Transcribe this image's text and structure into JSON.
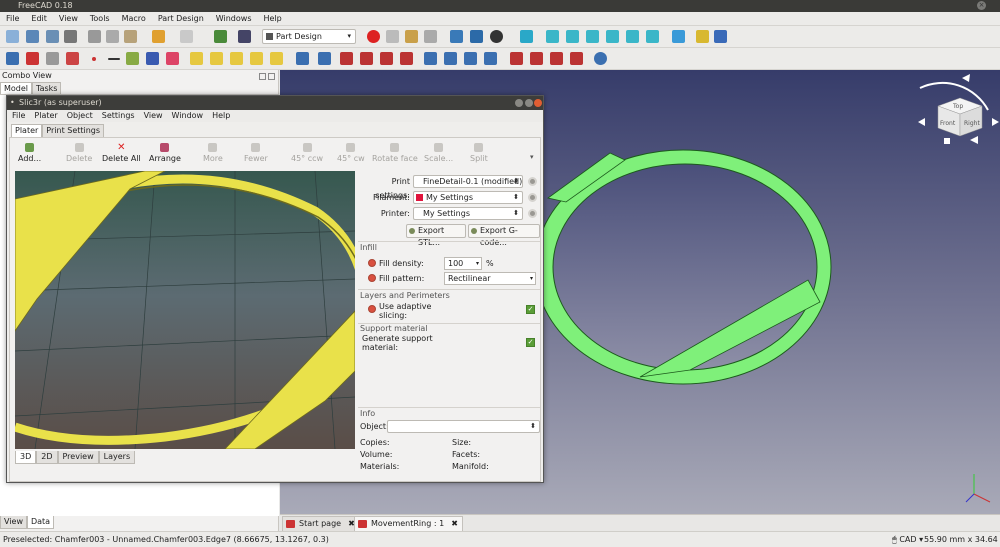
{
  "freecad": {
    "title": "FreeCAD 0.18",
    "menu": [
      "File",
      "Edit",
      "View",
      "Tools",
      "Macro",
      "Part Design",
      "Windows",
      "Help"
    ],
    "workbench": "Part Design",
    "combo": {
      "title": "Combo View",
      "tabs": [
        "Model",
        "Tasks"
      ],
      "bottom_tabs": [
        "View",
        "Data"
      ]
    },
    "doc_tabs": [
      "Start page",
      "MovementRing : 1"
    ],
    "status": {
      "preselected": "Preselected: Chamfer003 - Unnamed.Chamfer003.Edge7 (8.66675, 13.1267, 0.3)",
      "nav_style": "CAD",
      "dimensions": "55.90 mm x 34.64 mm"
    },
    "navcube_faces": [
      "Top",
      "Front",
      "Right"
    ]
  },
  "slic3r": {
    "title": "Slic3r (as superuser)",
    "menu": [
      "File",
      "Plater",
      "Object",
      "Settings",
      "View",
      "Window",
      "Help"
    ],
    "tabs": [
      "Plater",
      "Print Settings"
    ],
    "toolbar": [
      {
        "label": "Add...",
        "enabled": true,
        "name": "add"
      },
      {
        "label": "Delete",
        "enabled": false,
        "name": "delete"
      },
      {
        "label": "Delete All",
        "enabled": true,
        "name": "delete-all"
      },
      {
        "label": "Arrange",
        "enabled": true,
        "name": "arrange"
      },
      {
        "label": "More",
        "enabled": false,
        "name": "more"
      },
      {
        "label": "Fewer",
        "enabled": false,
        "name": "fewer"
      },
      {
        "label": "45° ccw",
        "enabled": false,
        "name": "rotate-ccw"
      },
      {
        "label": "45° cw",
        "enabled": false,
        "name": "rotate-cw"
      },
      {
        "label": "Rotate face",
        "enabled": false,
        "name": "rotate-face"
      },
      {
        "label": "Scale...",
        "enabled": false,
        "name": "scale"
      },
      {
        "label": "Split",
        "enabled": false,
        "name": "split"
      }
    ],
    "view_tabs": [
      "3D",
      "2D",
      "Preview",
      "Layers"
    ],
    "settings": {
      "print_label": "Print settings:",
      "print_value": "FineDetail-0.1 (modified)",
      "filament_label": "Filament:",
      "filament_value": "My Settings",
      "filament_color": "#e0143c",
      "printer_label": "Printer:",
      "printer_value": "My Settings",
      "export_stl": "Export STL...",
      "export_gcode": "Export G-code..."
    },
    "infill": {
      "title": "Infill",
      "density_label": "Fill density:",
      "density_value": "100",
      "density_unit": "%",
      "pattern_label": "Fill pattern:",
      "pattern_value": "Rectilinear"
    },
    "layers": {
      "title": "Layers and Perimeters",
      "adaptive_label_1": "Use adaptive",
      "adaptive_label_2": "slicing:",
      "adaptive_checked": true
    },
    "support": {
      "title": "Support material",
      "generate_label_1": "Generate support",
      "generate_label_2": "material:",
      "generate_checked": true
    },
    "info": {
      "title": "Info",
      "object_label": "Object:",
      "copies": "Copies:",
      "size": "Size:",
      "volume": "Volume:",
      "facets": "Facets:",
      "materials": "Materials:",
      "manifold": "Manifold:"
    }
  }
}
